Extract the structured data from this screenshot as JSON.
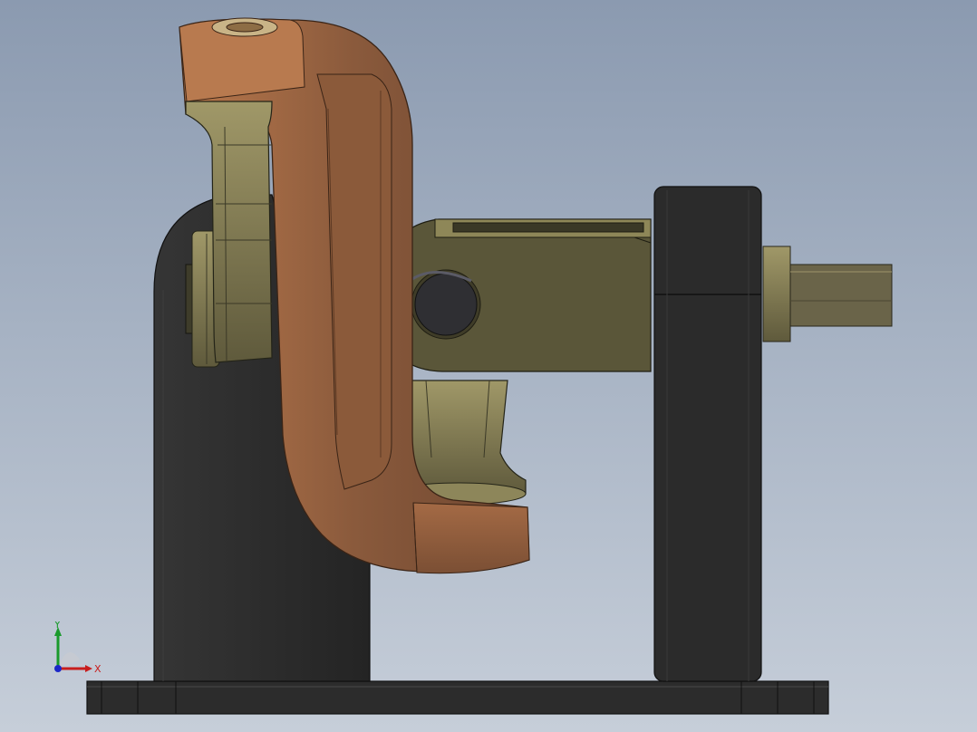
{
  "viewport": {
    "triad": {
      "x_label": "X",
      "y_label": "Y"
    }
  },
  "colors": {
    "background_top": "#8b9ab0",
    "background_bottom": "#c6ced9",
    "base_dark": "#2b2b2b",
    "copper": "#7a5037",
    "copper_light": "#a86c46",
    "olive": "#4f4c36",
    "olive_light": "#8d865a",
    "triad_x": "#c81d1d",
    "triad_y": "#1a9a2c",
    "triad_z": "#1b27c8"
  },
  "model": {
    "parts": [
      "base-plate",
      "left-support",
      "right-support",
      "copper-yoke",
      "olive-fork",
      "spider-block",
      "shaft",
      "pin"
    ]
  }
}
